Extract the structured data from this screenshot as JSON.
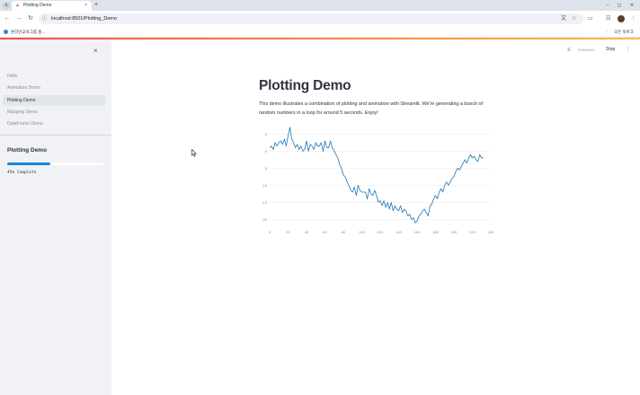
{
  "browser": {
    "tab_title": "Plotting Demo",
    "tab_close": "×",
    "new_tab": "+",
    "tab_menu": "v",
    "url": "localhost:8501/Plotting_Demo",
    "window_controls": [
      "–",
      "◻",
      "✕"
    ],
    "bookmark_label": "온라인교육그룹 홈...",
    "bookmark_folder": "모든 북마크",
    "icons": {
      "back": "back-arrow-icon",
      "forward": "forward-arrow-icon",
      "reload": "reload-icon",
      "site_info": "site-info-icon",
      "translate": "translate-icon",
      "star": "star-icon",
      "extensions": "puzzle-icon",
      "menu": "three-dots-icon"
    }
  },
  "sidebar": {
    "close": "×",
    "nav": [
      "Hello",
      "Animation Demo",
      "Plotting Demo",
      "Mapping Demo",
      "DataFrame Demo"
    ],
    "active_index": 2,
    "heading": "Plotting Demo",
    "progress": 0.45,
    "progress_text": "45% Complete"
  },
  "header": {
    "status": "RUNNING...",
    "stop": "Stop",
    "menu": "⋮"
  },
  "page": {
    "title": "Plotting Demo",
    "description": "This demo illustrates a combination of plotting and animation with Streamlit. We're generating a bunch of random numbers in a loop for around 5 seconds. Enjoy!"
  },
  "colors": {
    "line": "#1f77b4",
    "accent": "#ff4b4b",
    "progress": "#1c83e1",
    "sidebar_bg": "#f0f2f6"
  },
  "chart_data": {
    "type": "line",
    "title": "",
    "xlabel": "",
    "ylabel": "",
    "xlim": [
      0,
      240
    ],
    "ylim": [
      -22,
      8
    ],
    "x_ticks": [
      0,
      20,
      40,
      60,
      80,
      100,
      120,
      140,
      160,
      180,
      200,
      220,
      240
    ],
    "y_ticks": [
      5,
      0,
      -5,
      -10,
      -15,
      -20
    ],
    "grid": true,
    "legend": "none",
    "series": [
      {
        "x": [
          0,
          2,
          4,
          6,
          8,
          10,
          12,
          14,
          16,
          18,
          20,
          22,
          24,
          26,
          28,
          30,
          32,
          34,
          36,
          38,
          40,
          42,
          44,
          46,
          48,
          50,
          52,
          54,
          56,
          58,
          60,
          62,
          64,
          66,
          68,
          70,
          72,
          74,
          76,
          78,
          80,
          82,
          84,
          86,
          88,
          90,
          92,
          94,
          96,
          98,
          100,
          102,
          104,
          106,
          108,
          110,
          112,
          114,
          116,
          118,
          120,
          122,
          124,
          126,
          128,
          130,
          132,
          134,
          136,
          138,
          140,
          142,
          144,
          146,
          148,
          150,
          152,
          154,
          156,
          158,
          160,
          162,
          164,
          166,
          168,
          170,
          172,
          174,
          176,
          178,
          180,
          182,
          184,
          186,
          188,
          190,
          192,
          194,
          196,
          198,
          200,
          202,
          204,
          206,
          208,
          210,
          212,
          214,
          216,
          218,
          220,
          222,
          224,
          226,
          228,
          230,
          232
        ],
        "values": [
          1.0,
          1.5,
          0.5,
          2.5,
          1.5,
          2.5,
          3.0,
          2.0,
          3.5,
          1.5,
          4.5,
          7.0,
          3.5,
          2.5,
          1.0,
          2.0,
          0.5,
          1.5,
          0.0,
          0.5,
          3.0,
          0.0,
          2.0,
          1.5,
          0.5,
          2.5,
          1.5,
          1.5,
          2.5,
          0.0,
          3.0,
          1.0,
          1.0,
          3.0,
          1.0,
          0.0,
          -1.0,
          -2.0,
          -4.0,
          -5.0,
          -7.0,
          -7.5,
          -9.0,
          -10.0,
          -11.5,
          -12.0,
          -10.5,
          -13.0,
          -10.0,
          -11.5,
          -12.0,
          -12.0,
          -12.0,
          -14.0,
          -11.0,
          -12.5,
          -13.0,
          -11.5,
          -13.0,
          -15.0,
          -14.5,
          -16.0,
          -14.5,
          -16.5,
          -15.0,
          -17.0,
          -15.0,
          -17.5,
          -16.0,
          -17.0,
          -17.5,
          -16.0,
          -18.0,
          -17.0,
          -17.5,
          -19.0,
          -18.5,
          -20.0,
          -19.5,
          -21.0,
          -20.5,
          -19.0,
          -18.5,
          -17.5,
          -17.0,
          -18.0,
          -19.0,
          -16.0,
          -15.5,
          -14.0,
          -13.0,
          -14.0,
          -12.0,
          -11.0,
          -12.0,
          -10.0,
          -9.0,
          -10.0,
          -9.0,
          -8.0,
          -7.5,
          -6.0,
          -5.0,
          -5.5,
          -4.5,
          -3.5,
          -2.5,
          -3.5,
          -2.0,
          -1.0,
          -2.0,
          -1.5,
          -2.5,
          -3.0,
          -1.0,
          -2.0,
          -2.0
        ]
      }
    ]
  }
}
